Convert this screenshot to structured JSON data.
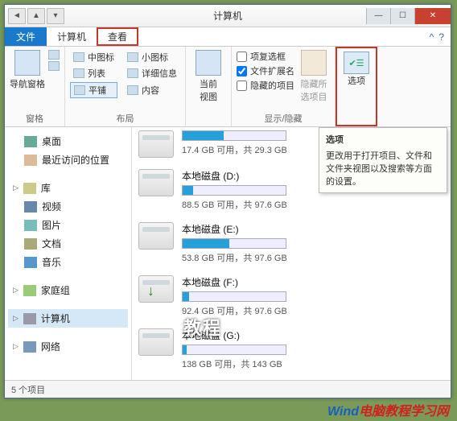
{
  "window": {
    "title": "计算机"
  },
  "tabs": {
    "file": "文件",
    "computer": "计算机",
    "view": "查看"
  },
  "ribbon": {
    "nav_pane": "导航窗格",
    "group_pane": "窗格",
    "layout": {
      "medium_icons": "中图标",
      "small_icons": "小图标",
      "list": "列表",
      "details": "详细信息",
      "tiles": "平铺",
      "content": "内容"
    },
    "group_layout": "布局",
    "current_view": "当前\n视图",
    "checks": {
      "item_checkboxes": "项复选框",
      "file_ext": "文件扩展名",
      "hidden_items": "隐藏的项目"
    },
    "hide_selected": "隐藏所\n选项目",
    "group_showhide": "显示/隐藏",
    "options": "选项"
  },
  "tooltip": {
    "title": "选项",
    "body": "更改用于打开项目、文件和文件夹视图以及搜索等方面的设置。"
  },
  "sidebar": {
    "desktop": "桌面",
    "recent": "最近访问的位置",
    "libraries": "库",
    "videos": "视频",
    "pictures": "图片",
    "documents": "文档",
    "music": "音乐",
    "homegroup": "家庭组",
    "computer": "计算机",
    "network": "网络"
  },
  "drives": [
    {
      "name": "",
      "info": "17.4 GB 可用，共 29.3 GB",
      "fill": 40
    },
    {
      "name": "本地磁盘 (D:)",
      "info": "88.5 GB 可用，共 97.6 GB",
      "fill": 10
    },
    {
      "name": "本地磁盘 (E:)",
      "info": "53.8 GB 可用，共 97.6 GB",
      "fill": 45
    },
    {
      "name": "本地磁盘 (F:)",
      "info": "92.4 GB 可用，共 97.6 GB",
      "fill": 6
    },
    {
      "name": "本地磁盘 (G:)",
      "info": "138 GB 可用，共 143 GB",
      "fill": 4
    }
  ],
  "status": {
    "items": "5 个项目"
  },
  "watermark": {
    "blue": "Wind",
    "red": "电脑教程学习网"
  },
  "overlay": "教程"
}
